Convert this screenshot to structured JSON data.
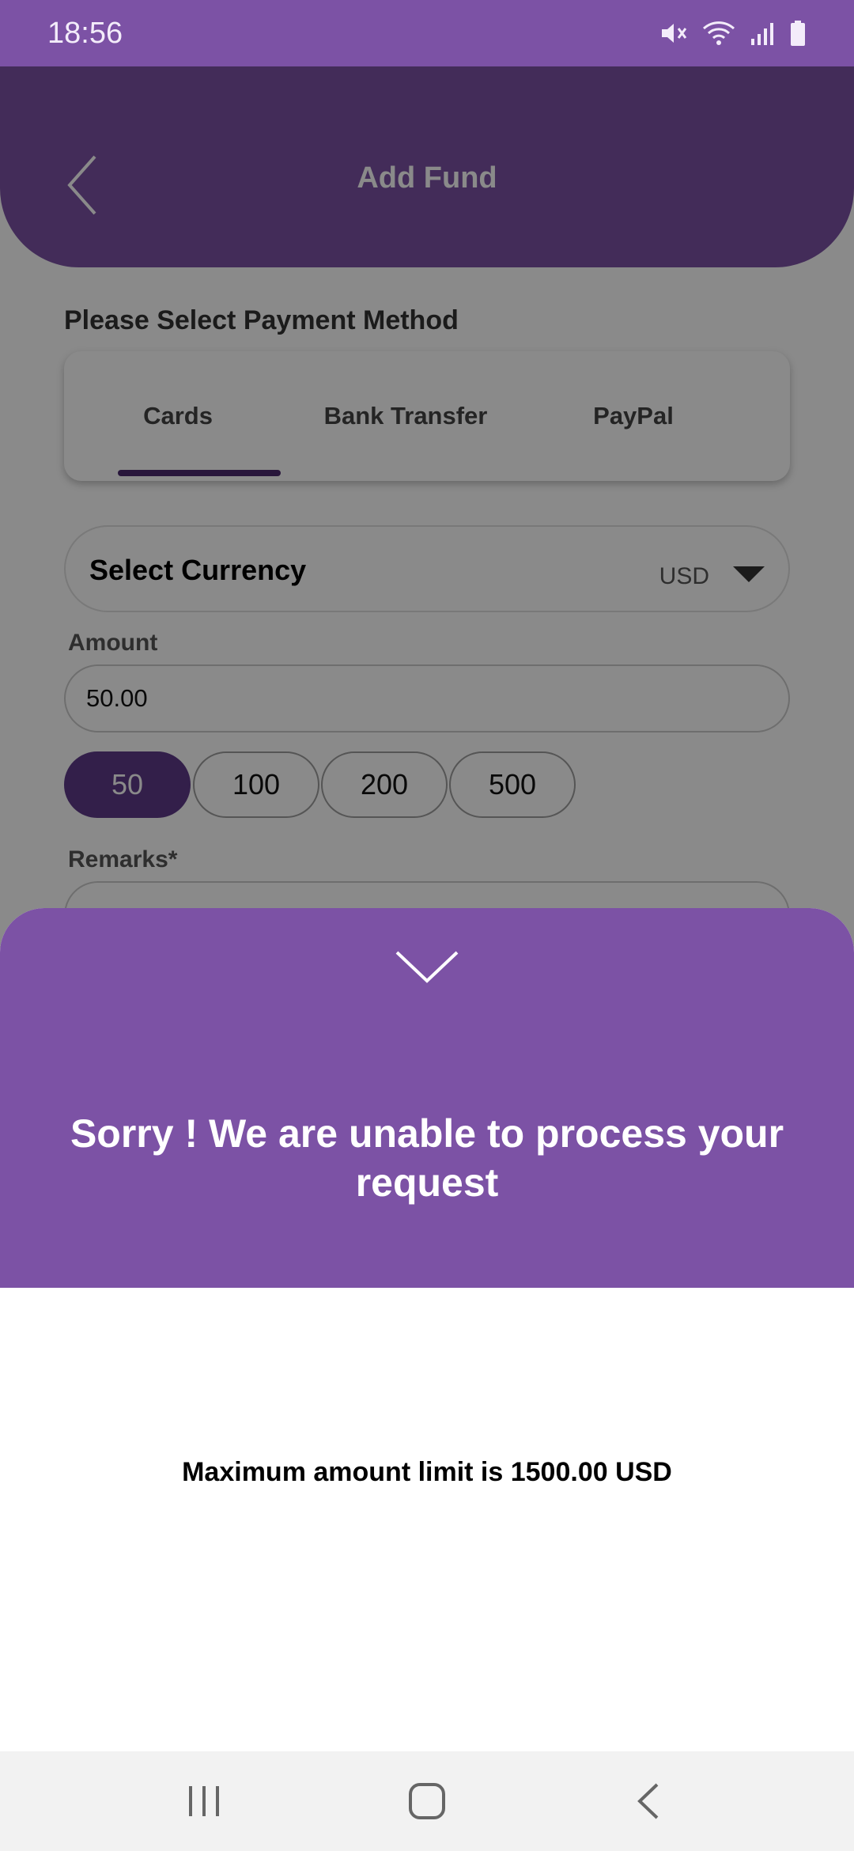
{
  "status_bar": {
    "time": "18:56",
    "icons": [
      "mute-icon",
      "wifi-icon",
      "signal-icon",
      "battery-icon"
    ]
  },
  "header": {
    "title": "Add Fund",
    "back_icon": "chevron-left-icon"
  },
  "payment_method": {
    "label": "Please Select Payment Method",
    "tabs": [
      {
        "label": "Cards",
        "selected": true
      },
      {
        "label": "Bank Transfer",
        "selected": false
      },
      {
        "label": "PayPal",
        "selected": false
      }
    ]
  },
  "currency": {
    "label": "Select Currency",
    "value": "USD"
  },
  "amount": {
    "label": "Amount",
    "value": "50.00",
    "presets": [
      "50",
      "100",
      "200",
      "500"
    ],
    "selected_preset": "50"
  },
  "remarks": {
    "label": "Remarks*"
  },
  "sheet": {
    "title": "Sorry ! We are unable to process your request",
    "message": "Maximum amount limit is 1500.00 USD",
    "collapse_icon": "chevron-down-icon"
  },
  "nav_bar": {
    "icons": [
      "recents-icon",
      "home-icon",
      "back-icon"
    ]
  },
  "colors": {
    "primary": "#7c52a5",
    "primary_dark": "#5e3a8a",
    "scrim": "#000000"
  }
}
